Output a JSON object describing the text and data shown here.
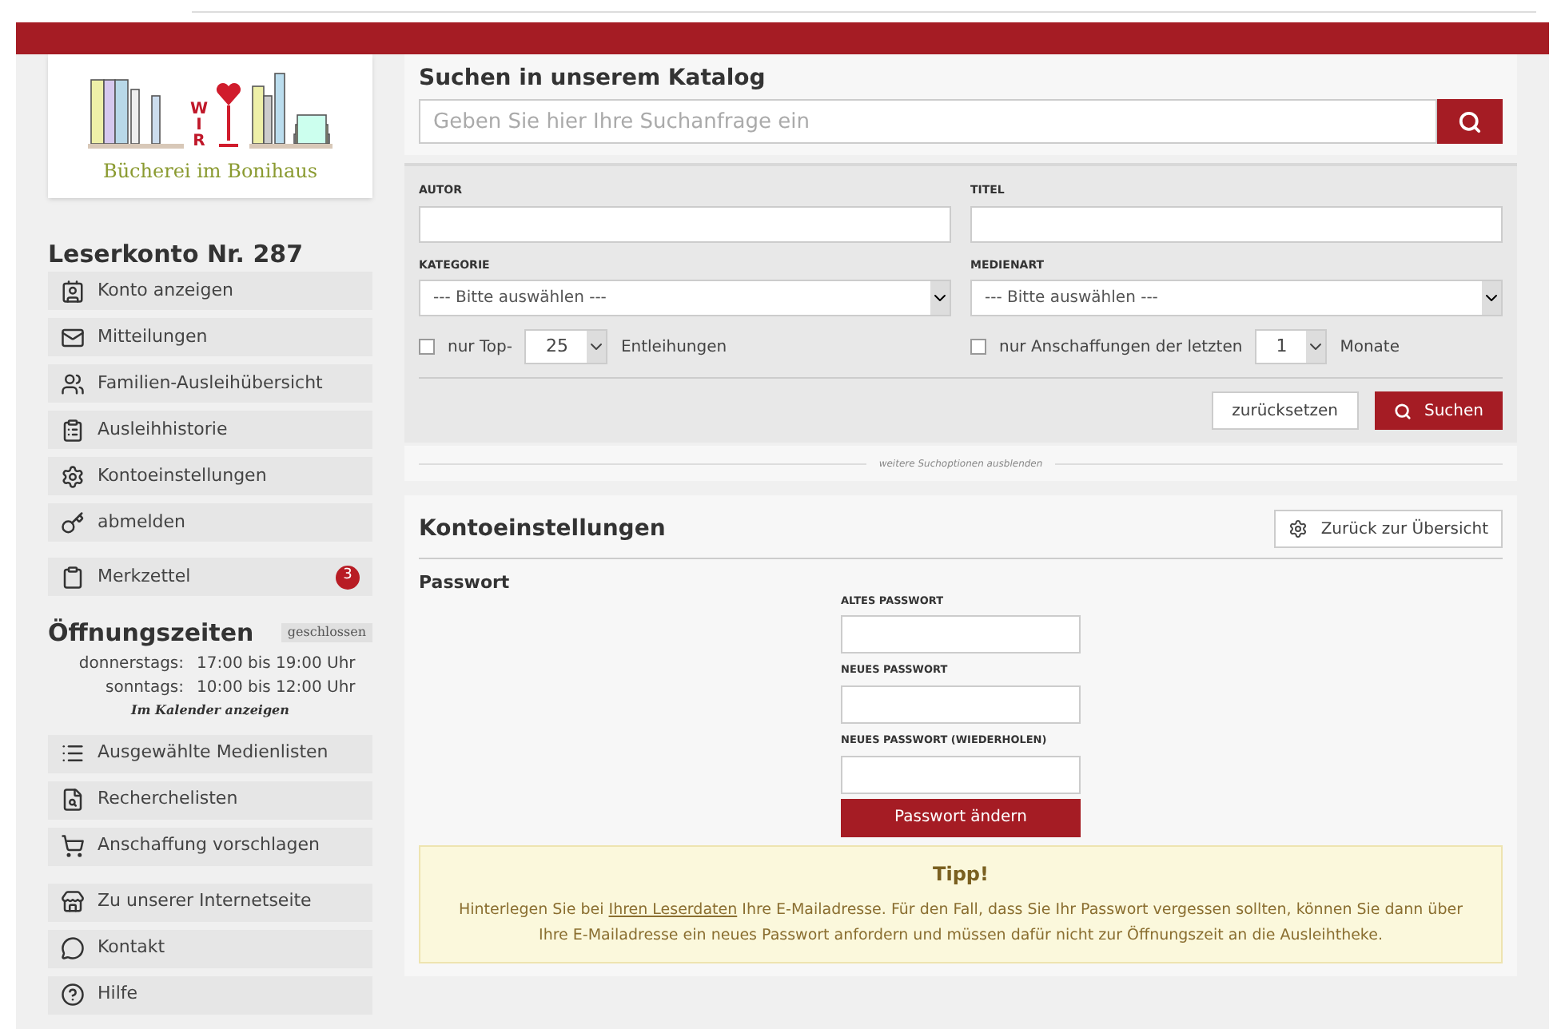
{
  "logo": {
    "letters": [
      "W",
      "I",
      "R"
    ],
    "name": "Bücherei im Bonihaus"
  },
  "account": {
    "title": "Leserkonto Nr. 287",
    "items": [
      {
        "label": "Konto anzeigen"
      },
      {
        "label": "Mitteilungen"
      },
      {
        "label": "Familien-Ausleihübersicht"
      },
      {
        "label": "Ausleihhistorie"
      },
      {
        "label": "Kontoeinstellungen"
      },
      {
        "label": "abmelden"
      }
    ],
    "notepad": {
      "label": "Merkzettel",
      "count": "3"
    }
  },
  "opening": {
    "title": "Öffnungszeiten",
    "status": "geschlossen",
    "rows": [
      {
        "day": "donnerstags:",
        "time": "17:00 bis 19:00 Uhr"
      },
      {
        "day": "sonntags:",
        "time": "10:00 bis 12:00 Uhr"
      }
    ],
    "calendar_link": "Im Kalender anzeigen"
  },
  "links": [
    {
      "label": "Ausgewählte Medienlisten"
    },
    {
      "label": "Recherchelisten"
    },
    {
      "label": "Anschaffung vorschlagen"
    }
  ],
  "links2": [
    {
      "label": "Zu unserer Internetseite"
    },
    {
      "label": "Kontakt"
    },
    {
      "label": "Hilfe"
    }
  ],
  "search": {
    "title": "Suchen in unserem Katalog",
    "placeholder": "Geben Sie hier Ihre Suchanfrage ein"
  },
  "advanced": {
    "author_label": "AUTOR",
    "title_label": "TITEL",
    "category": {
      "label": "KATEGORIE",
      "value": "--- Bitte auswählen ---"
    },
    "media": {
      "label": "MEDIENART",
      "value": "--- Bitte auswählen ---"
    },
    "top": {
      "checked": false,
      "prefix": "nur Top-",
      "value": "25",
      "suffix": "Entleihungen"
    },
    "recent": {
      "checked": false,
      "prefix": "nur Anschaffungen der letzten",
      "value": "1",
      "suffix": "Monate"
    },
    "reset": "zurücksetzen",
    "submit": "Suchen",
    "toggle": "weitere Suchoptionen ausblenden"
  },
  "settings": {
    "title": "Kontoeinstellungen",
    "back": "Zurück zur Übersicht",
    "section": "Passwort",
    "fields": [
      {
        "label": "ALTES PASSWORT"
      },
      {
        "label": "NEUES PASSWORT"
      },
      {
        "label": "NEUES PASSWORT (WIEDERHOLEN)"
      }
    ],
    "submit": "Passwort ändern",
    "tip": {
      "title": "Tipp!",
      "before": "Hinterlegen Sie bei",
      "link": "Ihren Leserdaten",
      "after": "Ihre E-Mailadresse. Für den Fall, dass Sie Ihr Passwort vergessen sollten, können Sie dann über Ihre E-Mailadresse ein neues Passwort anfordern und müssen dafür nicht zur Öffnungszeit an die Ausleihtheke."
    }
  }
}
